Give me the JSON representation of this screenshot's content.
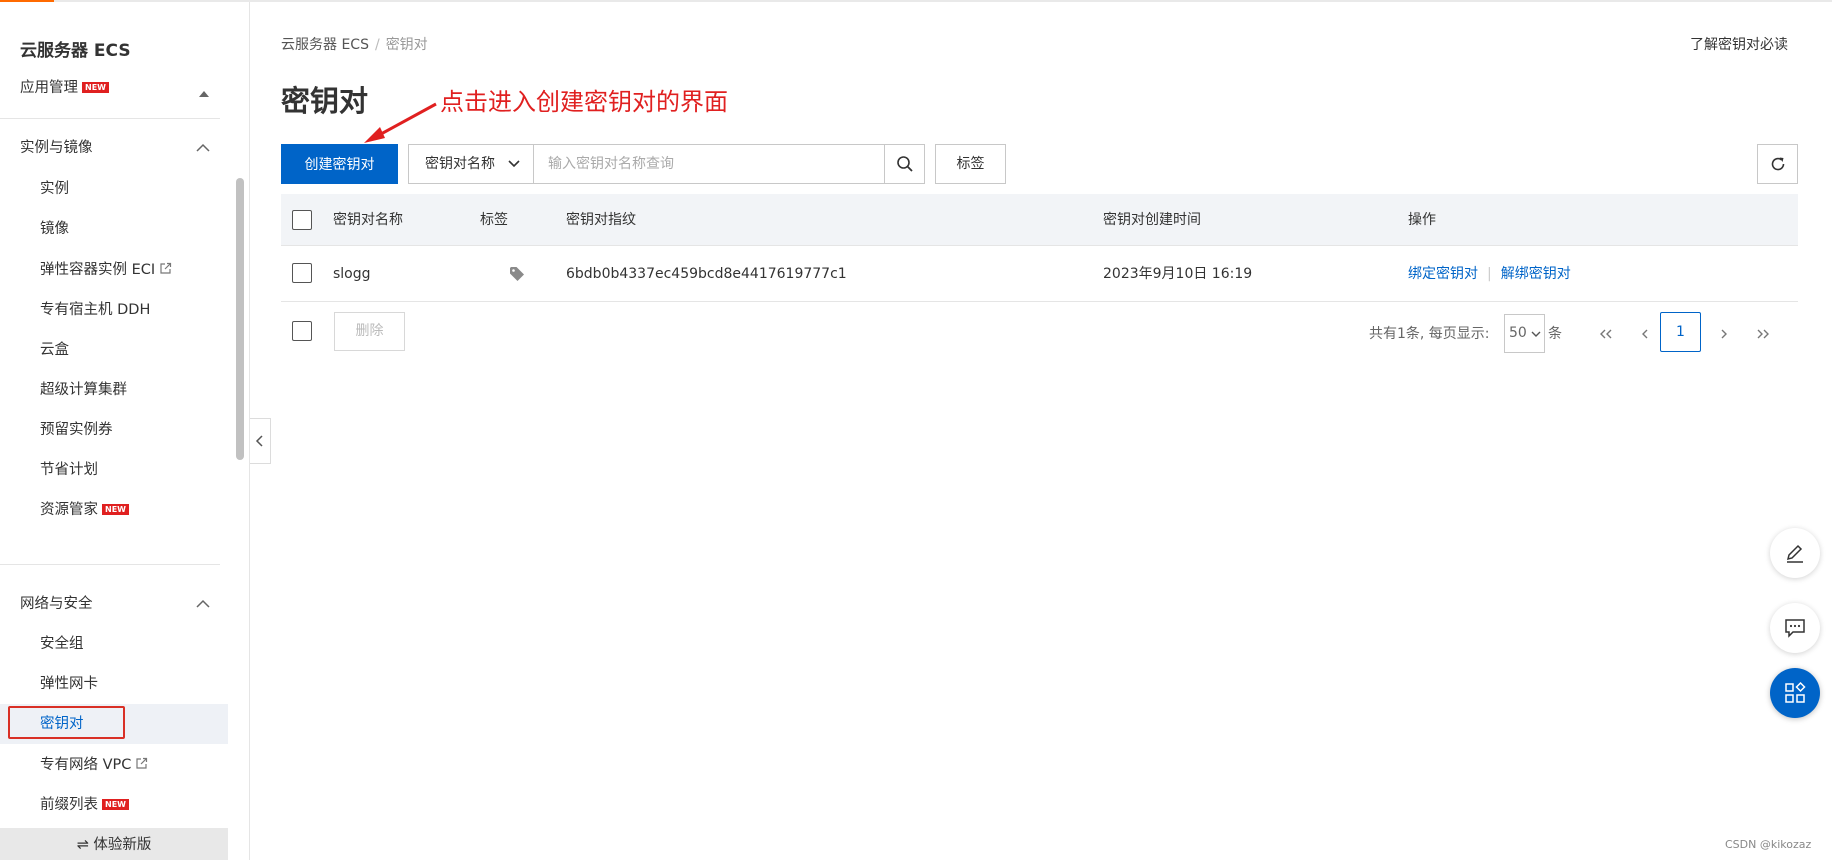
{
  "sidebar": {
    "title": "云服务器 ECS",
    "app_manage": "应用管理",
    "new_badge": "NEW",
    "group_instances": "实例与镜像",
    "items_instances": [
      "实例",
      "镜像",
      "弹性容器实例 ECI",
      "专有宿主机 DDH",
      "云盒",
      "超级计算集群",
      "预留实例券",
      "节省计划",
      "资源管家"
    ],
    "group_network": "网络与安全",
    "items_network": [
      "安全组",
      "弹性网卡",
      "密钥对",
      "专有网络 VPC",
      "前缀列表"
    ],
    "active_item": "密钥对",
    "bottom_button": "⇌ 体验新版"
  },
  "breadcrumb": {
    "root": "云服务器 ECS",
    "separator": "/",
    "current": "密钥对"
  },
  "help_link": "了解密钥对必读",
  "page_title": "密钥对",
  "annotation": "点击进入创建密钥对的界面",
  "toolbar": {
    "create_button": "创建密钥对",
    "filter_select": "密钥对名称",
    "search_placeholder": "输入密钥对名称查询",
    "tag_button": "标签"
  },
  "table": {
    "columns": [
      "密钥对名称",
      "标签",
      "密钥对指纹",
      "密钥对创建时间",
      "操作"
    ],
    "rows": [
      {
        "name": "slogg",
        "fingerprint": "6bdb0b4337ec459bcd8e4417619777c1",
        "created": "2023年9月10日 16:19",
        "action_bind": "绑定密钥对",
        "action_unbind": "解绑密钥对"
      }
    ]
  },
  "footer": {
    "delete_button": "删除",
    "total_text": "共有1条, 每页显示:",
    "page_size": "50",
    "unit": "条",
    "current_page": "1"
  },
  "watermark": "CSDN @kikozaz",
  "colors": {
    "primary": "#0064c8",
    "annotation": "#e02020",
    "brand_orange": "#ff6a00"
  }
}
